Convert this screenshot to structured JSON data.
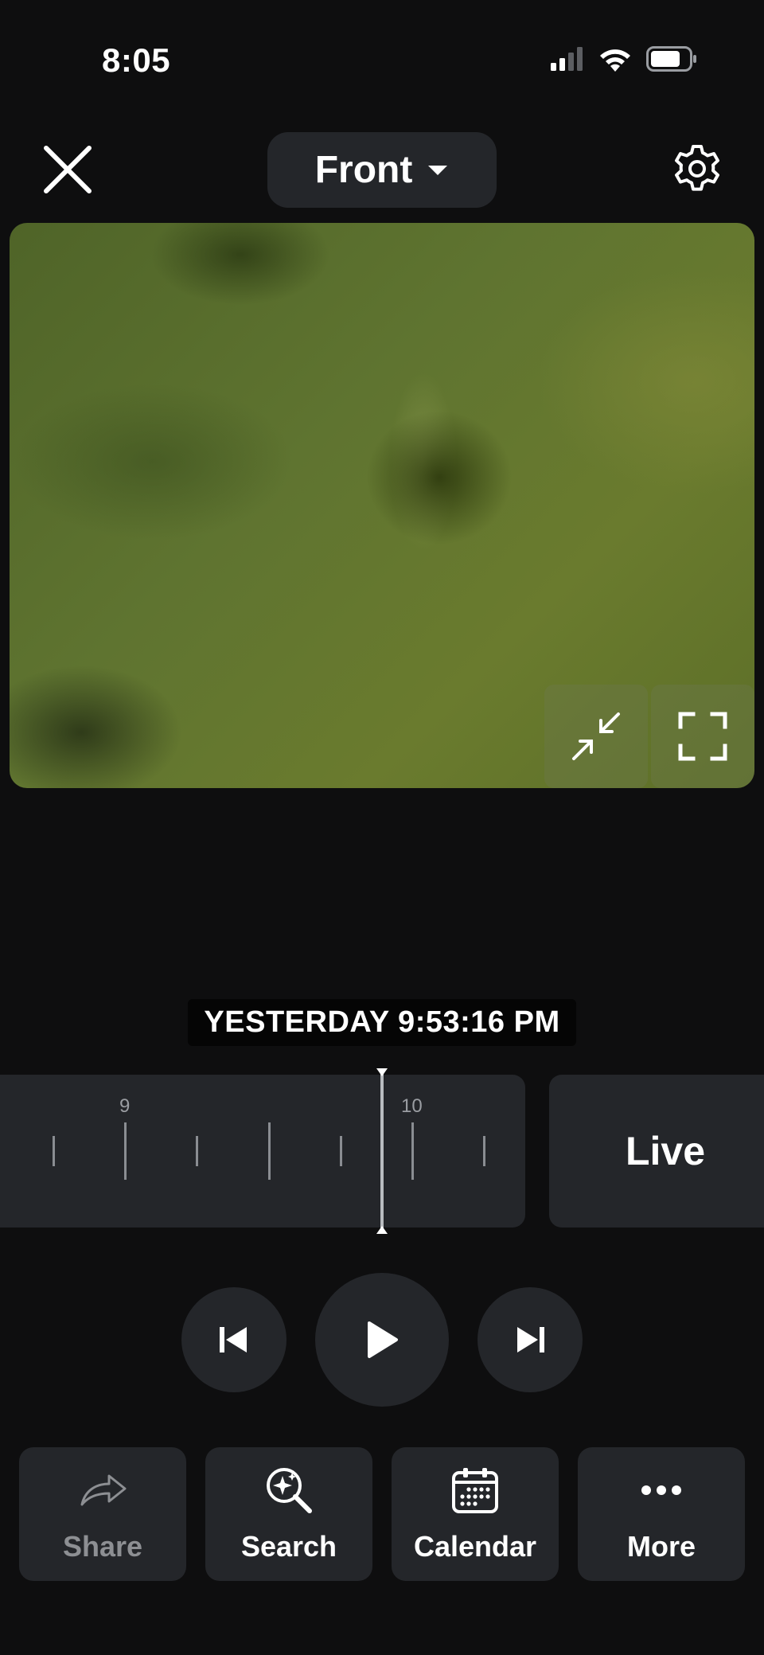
{
  "status_bar": {
    "time": "8:05",
    "icons": [
      "cellular-signal-icon",
      "wifi-icon",
      "battery-icon"
    ]
  },
  "header": {
    "close_icon": "close-icon",
    "camera_name": "Front",
    "dropdown_icon": "caret-down-icon",
    "settings_icon": "gear-icon"
  },
  "video": {
    "controls": [
      "minimize-icon",
      "fullscreen-icon"
    ]
  },
  "timestamp": "YESTERDAY 9:53:16 PM",
  "timeline": {
    "labels": [
      "9",
      "10"
    ]
  },
  "live_label": "Live",
  "playback": {
    "buttons": [
      "skip-previous-icon",
      "play-icon",
      "skip-next-icon"
    ]
  },
  "actions": [
    {
      "label": "Share",
      "icon": "share-icon",
      "enabled": false
    },
    {
      "label": "Search",
      "icon": "smart-search-icon",
      "enabled": true
    },
    {
      "label": "Calendar",
      "icon": "calendar-icon",
      "enabled": true
    },
    {
      "label": "More",
      "icon": "more-icon",
      "enabled": true
    }
  ],
  "colors": {
    "background": "#0e0e0f",
    "surface": "#24262a",
    "text": "#ffffff",
    "disabled_text": "#8d8f93"
  }
}
